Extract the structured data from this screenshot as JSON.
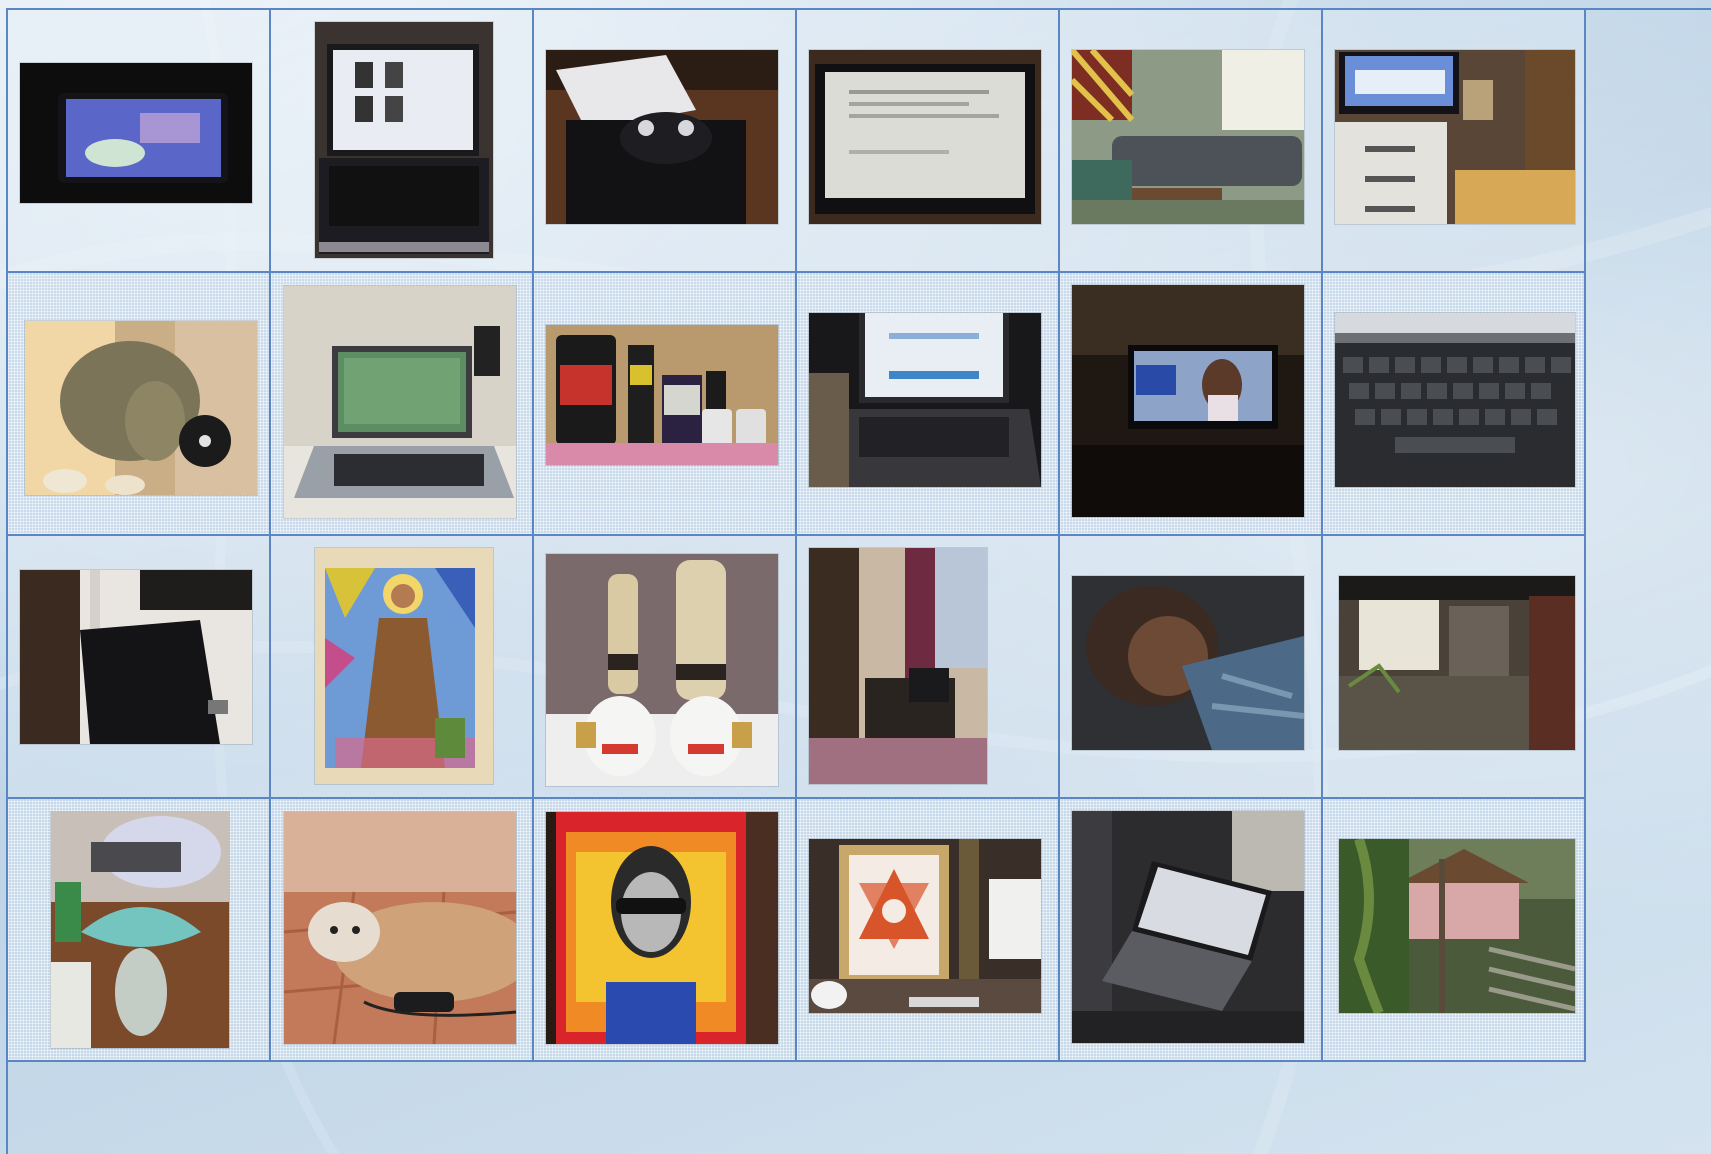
{
  "gallery": {
    "rows": 4,
    "columns": 6,
    "photos": [
      "photo-tablet-screen",
      "photo-laptop-open",
      "photo-gamepad-on-console",
      "photo-monitor-screen",
      "photo-living-room-sofa",
      "photo-tv-above-dresser",
      "photo-elephant-figurine",
      "photo-silver-laptop-desk",
      "photo-supplement-containers",
      "photo-laptop-dark-room",
      "photo-tv-dark-room",
      "photo-keyboard-closeup",
      "photo-black-chair",
      "photo-saint-painting",
      "photo-vases-lucky-cats",
      "photo-bedroom-doorway",
      "photo-person-sleeping",
      "photo-house-exterior",
      "photo-pacifier-closeup",
      "photo-dog-lying",
      "photo-portrait-painting",
      "photo-framed-yantra",
      "photo-laptop-on-sofa",
      "photo-garden-stone-steps"
    ]
  }
}
